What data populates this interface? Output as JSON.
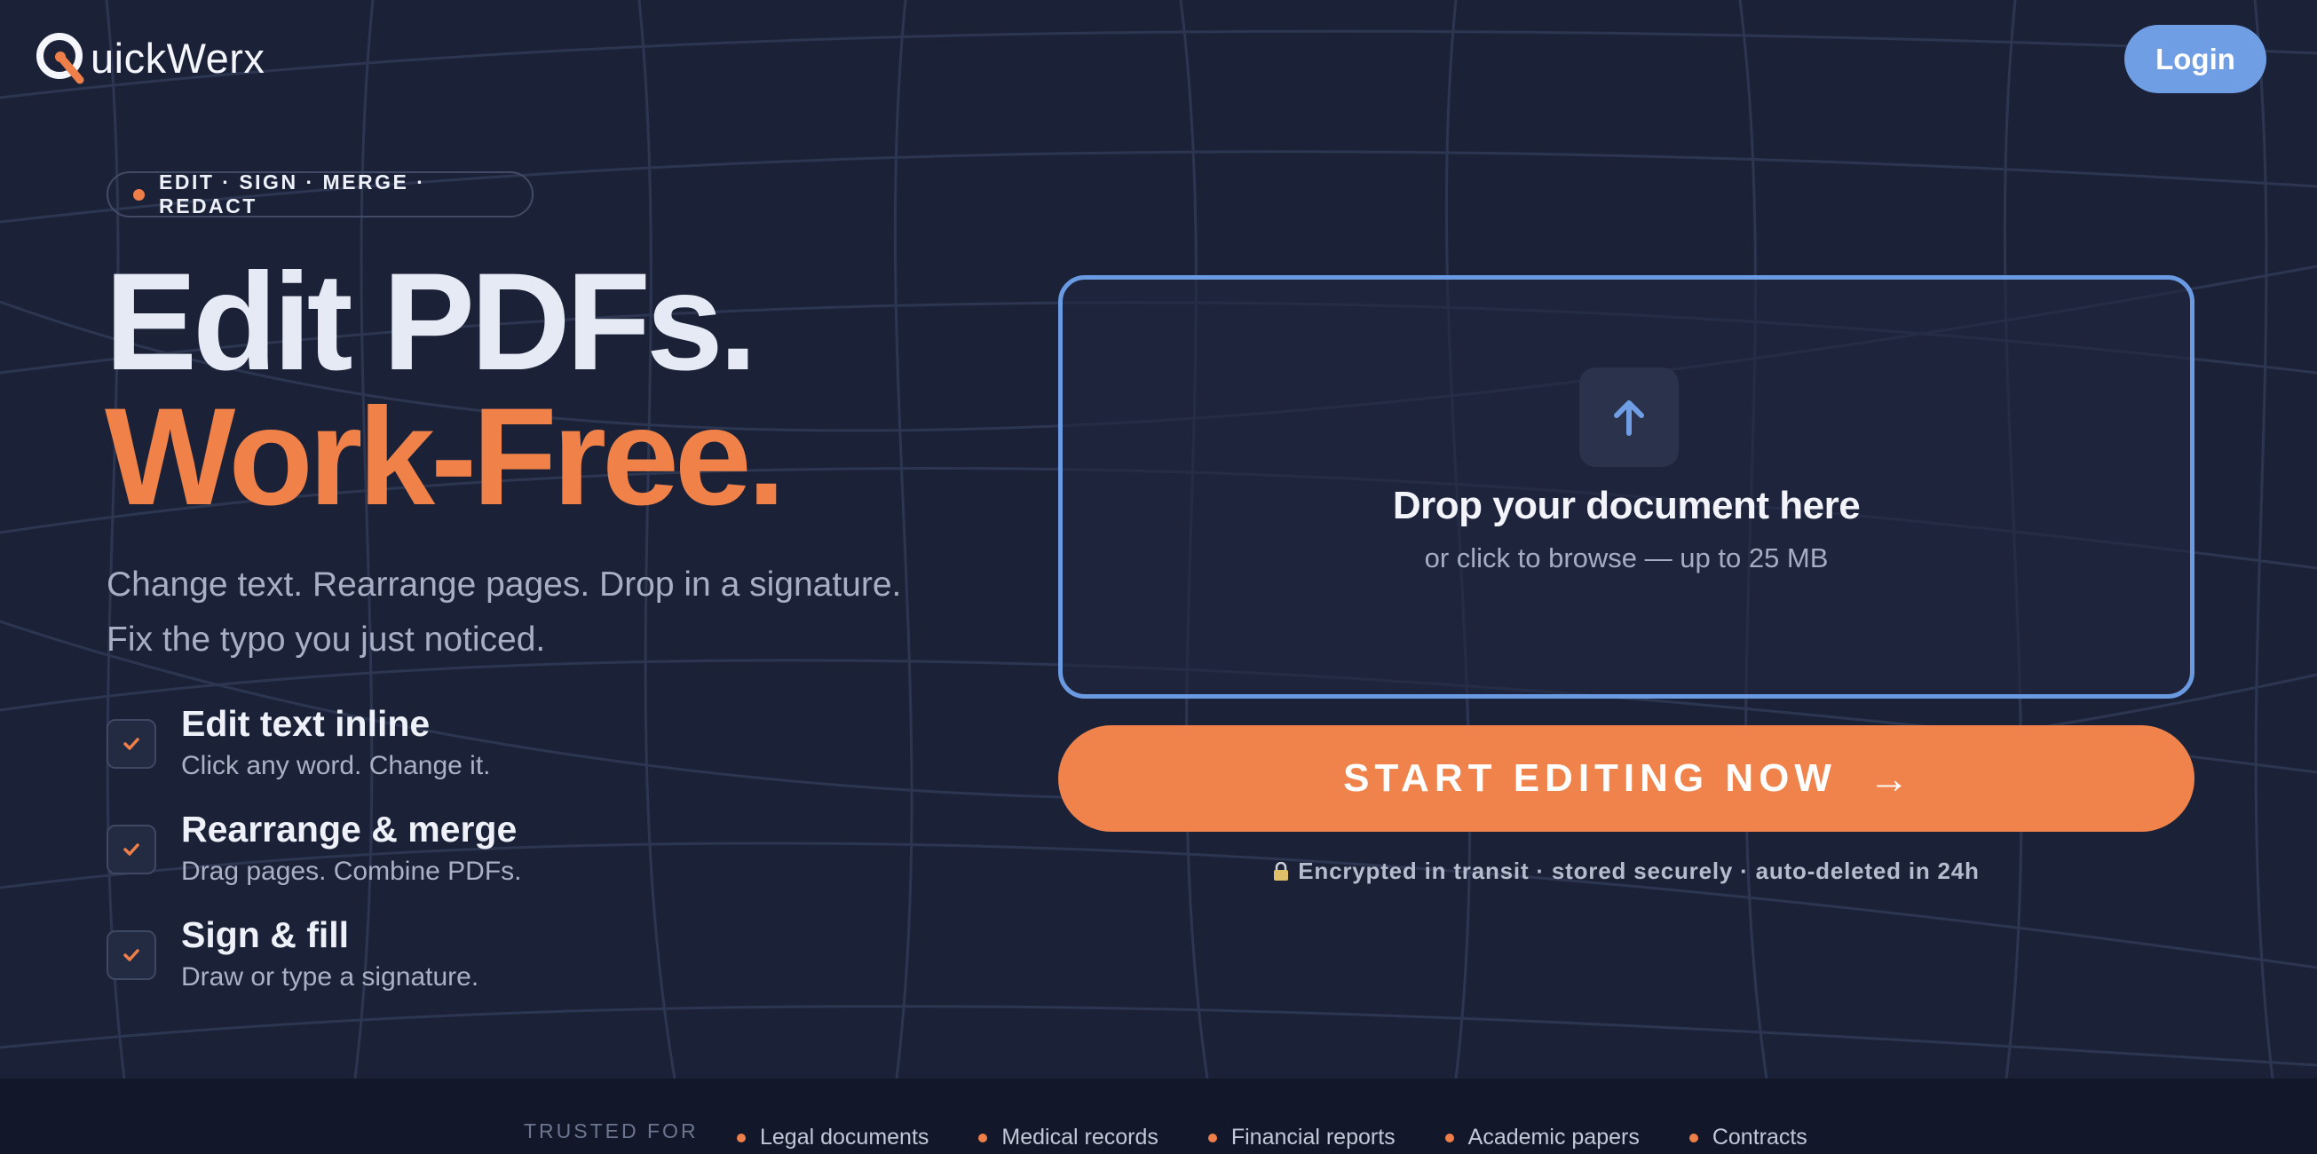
{
  "header": {
    "logo_text": "uickWerx",
    "login_label": "Login"
  },
  "hero": {
    "pill_text": "EDIT · SIGN · MERGE · REDACT",
    "headline_line1": "Edit PDFs.",
    "headline_line2": "Work-Free.",
    "subtitle_line1": "Change text. Rearrange pages. Drop in a signature.",
    "subtitle_line2": "Fix the typo you just noticed."
  },
  "features": [
    {
      "title": "Edit text inline",
      "desc": "Click any word. Change it."
    },
    {
      "title": "Rearrange & merge",
      "desc": "Drag pages. Combine PDFs."
    },
    {
      "title": "Sign & fill",
      "desc": "Draw or type a signature."
    }
  ],
  "dropzone": {
    "icon": "upload-arrow-icon",
    "title": "Drop your document here",
    "subtitle": "or click to browse — up to 25 MB"
  },
  "cta": {
    "label": "START EDITING NOW",
    "arrow": "→"
  },
  "security_note": "Encrypted in transit · stored securely · auto-deleted in 24h",
  "footer": {
    "trusted_label": "TRUSTED FOR",
    "items": [
      "Legal documents",
      "Medical records",
      "Financial reports",
      "Academic papers",
      "Contracts"
    ]
  },
  "colors": {
    "background": "#1b2238",
    "accent_orange": "#ef8149",
    "accent_blue": "#6a9be2",
    "footer_bg": "#121829"
  }
}
